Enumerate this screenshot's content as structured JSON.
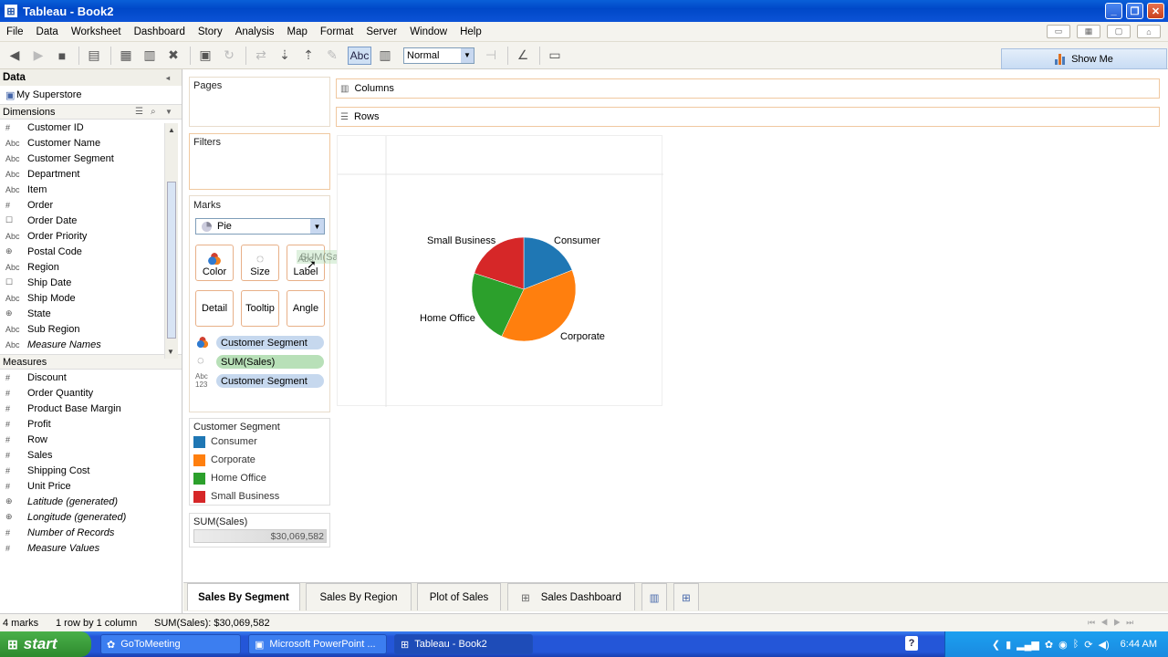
{
  "window": {
    "title": "Tableau - Book2",
    "min": "_",
    "max": "❐",
    "close": "✕"
  },
  "menu": [
    "File",
    "Data",
    "Worksheet",
    "Dashboard",
    "Story",
    "Analysis",
    "Map",
    "Format",
    "Server",
    "Window",
    "Help"
  ],
  "toolbar": {
    "abc_label": "Abc",
    "view_size": "Normal",
    "show_me": "Show Me"
  },
  "data_pane": {
    "header": "Data",
    "datasource": "My Superstore",
    "dimensions_label": "Dimensions",
    "dimensions": [
      {
        "icon": "#",
        "label": "Customer ID",
        "italic": false
      },
      {
        "icon": "Abc",
        "label": "Customer Name",
        "italic": false
      },
      {
        "icon": "Abc",
        "label": "Customer Segment",
        "italic": false
      },
      {
        "icon": "Abc",
        "label": "Department",
        "italic": false
      },
      {
        "icon": "Abc",
        "label": "Item",
        "italic": false
      },
      {
        "icon": "#",
        "label": "Order",
        "italic": false
      },
      {
        "icon": "☐",
        "label": "Order Date",
        "italic": false
      },
      {
        "icon": "Abc",
        "label": "Order Priority",
        "italic": false
      },
      {
        "icon": "⊕",
        "label": "Postal Code",
        "italic": false
      },
      {
        "icon": "Abc",
        "label": "Region",
        "italic": false
      },
      {
        "icon": "☐",
        "label": "Ship Date",
        "italic": false
      },
      {
        "icon": "Abc",
        "label": "Ship Mode",
        "italic": false
      },
      {
        "icon": "⊕",
        "label": "State",
        "italic": false
      },
      {
        "icon": "Abc",
        "label": "Sub Region",
        "italic": false
      },
      {
        "icon": "Abc",
        "label": "Measure Names",
        "italic": true
      }
    ],
    "measures_label": "Measures",
    "measures": [
      {
        "icon": "#",
        "label": "Discount",
        "italic": false
      },
      {
        "icon": "#",
        "label": "Order Quantity",
        "italic": false
      },
      {
        "icon": "#",
        "label": "Product Base Margin",
        "italic": false
      },
      {
        "icon": "#",
        "label": "Profit",
        "italic": false
      },
      {
        "icon": "#",
        "label": "Row",
        "italic": false
      },
      {
        "icon": "#",
        "label": "Sales",
        "italic": false
      },
      {
        "icon": "#",
        "label": "Shipping Cost",
        "italic": false
      },
      {
        "icon": "#",
        "label": "Unit Price",
        "italic": false
      },
      {
        "icon": "⊕",
        "label": "Latitude (generated)",
        "italic": true
      },
      {
        "icon": "⊕",
        "label": "Longitude (generated)",
        "italic": true
      },
      {
        "icon": "#",
        "label": "Number of Records",
        "italic": true
      },
      {
        "icon": "#",
        "label": "Measure Values",
        "italic": true
      }
    ]
  },
  "pages_label": "Pages",
  "filters_label": "Filters",
  "marks": {
    "header": "Marks",
    "type": "Pie",
    "buttons": [
      "Color",
      "Size",
      "Label",
      "Detail",
      "Tooltip",
      "Angle"
    ],
    "drag_ghost": "SUM(Sales)",
    "pills": [
      {
        "label": "Customer Segment",
        "kind": "color"
      },
      {
        "label": "SUM(Sales)",
        "kind": "size"
      },
      {
        "label": "Customer Segment",
        "kind": "label"
      }
    ]
  },
  "shelves": {
    "columns": "Columns",
    "rows": "Rows"
  },
  "legend": {
    "title": "Customer Segment",
    "items": [
      {
        "label": "Consumer",
        "color": "#1f77b4"
      },
      {
        "label": "Corporate",
        "color": "#ff7f0e"
      },
      {
        "label": "Home Office",
        "color": "#2ca02c"
      },
      {
        "label": "Small Business",
        "color": "#d62728"
      }
    ]
  },
  "size_legend": {
    "title": "SUM(Sales)",
    "value": "$30,069,582"
  },
  "tabs": [
    "Sales By Segment",
    "Sales By Region",
    "Plot of Sales",
    "Sales Dashboard"
  ],
  "status": {
    "marks": "4 marks",
    "dims": "1 row by 1 column",
    "sum": "SUM(Sales): $30,069,582"
  },
  "taskbar": {
    "start": "start",
    "tasks": [
      "GoToMeeting",
      "Microsoft PowerPoint ...",
      "Tableau - Book2"
    ],
    "clock": "6:44 AM"
  },
  "chart_data": {
    "type": "pie",
    "categories": [
      "Consumer",
      "Corporate",
      "Home Office",
      "Small Business"
    ],
    "values": [
      0.19,
      0.38,
      0.23,
      0.2
    ],
    "colors": [
      "#1f77b4",
      "#ff7f0e",
      "#2ca02c",
      "#d62728"
    ]
  }
}
